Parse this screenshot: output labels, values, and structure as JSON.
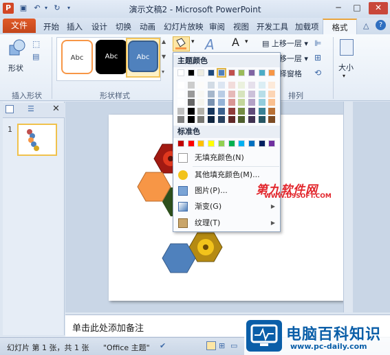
{
  "app": {
    "title": "演示文稿2 - Microsoft PowerPoint",
    "logo": "P",
    "min": "─",
    "max": "□",
    "close": "✕"
  },
  "tabs": {
    "file": "文件",
    "items": [
      "开始",
      "插入",
      "设计",
      "切换",
      "动画",
      "幻灯片放映",
      "审阅",
      "视图",
      "开发工具",
      "加载项"
    ],
    "format": "格式"
  },
  "ribbon": {
    "insert_shapes_group": "插入形状",
    "shapes_label": "形状",
    "shape_styles_group": "形状样式",
    "arrange_group": "排列",
    "size_label": "大小",
    "style_sample": "Abc",
    "bring_forward": "上移一层",
    "send_backward": "下移一层",
    "selection_pane": "选择窗格"
  },
  "fill_menu": {
    "theme_colors_header": "主题颜色",
    "standard_colors_header": "标准色",
    "theme_colors_top": [
      "#ffffff",
      "#000000",
      "#eeece1",
      "#1f497d",
      "#4f81bd",
      "#c0504d",
      "#9bbb59",
      "#8064a2",
      "#4bacc6",
      "#f79646"
    ],
    "standard_colors": [
      "#c00000",
      "#ff0000",
      "#ffc000",
      "#ffff00",
      "#92d050",
      "#00b050",
      "#00b0f0",
      "#0070c0",
      "#002060",
      "#7030a0"
    ],
    "no_fill": "无填充颜色(N)",
    "more_fill": "其他填充颜色(M)...",
    "picture": "图片(P)...",
    "gradient": "渐变(G)",
    "texture": "纹理(T)"
  },
  "slides_pane": {
    "slide_number": "1"
  },
  "notes": {
    "placeholder": "单击此处添加备注"
  },
  "status": {
    "slide_info": "幻灯片 第 1 张，共 1 张",
    "theme": "\"Office 主题\""
  },
  "watermarks": {
    "site_text": "第九软件网",
    "site_url": "WWW.D9SOFT.COM",
    "brand_text": "电脑百科知识",
    "brand_url": "www.pc-daily.com"
  }
}
